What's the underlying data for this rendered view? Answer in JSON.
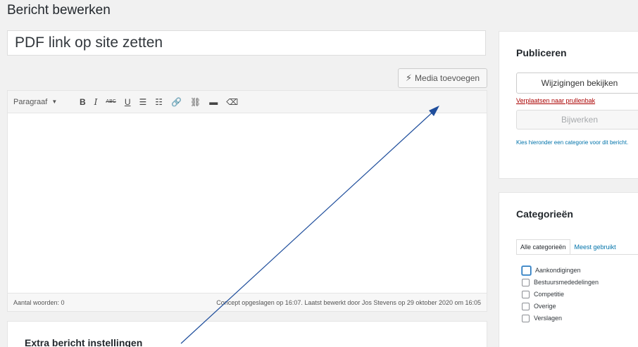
{
  "page": {
    "title": "Bericht bewerken"
  },
  "post": {
    "title": "PDF link op site zetten"
  },
  "editor": {
    "add_media": "Media toevoegen",
    "toolbar": {
      "format": "Paragraaf",
      "bold": "B",
      "italic": "I",
      "strikethrough": "ABC",
      "underline": "U",
      "bullets": "☰",
      "numbers": "☷",
      "link": "🔗",
      "unlink": "⛓",
      "readmore": "▬",
      "clear": "⌫"
    },
    "word_count": "Aantal woorden: 0",
    "save_status": "Concept opgeslagen op 16:07. Laatst bewerkt door Jos Stevens op 29 oktober 2020 om 16:05"
  },
  "extra": {
    "title": "Extra bericht instellingen"
  },
  "publish": {
    "title": "Publiceren",
    "preview": "Wijzigingen bekijken",
    "trash": "Verplaatsen naar prullenbak",
    "update": "Bijwerken",
    "note": "Kies hieronder een categorie voor dit bericht."
  },
  "categories": {
    "title": "Categorieën",
    "tabs": [
      "Alle categorieën",
      "Meest gebruikt"
    ],
    "items": [
      "Aankondigingen",
      "Bestuursmededelingen",
      "Competitie",
      "Overige",
      "Verslagen"
    ]
  },
  "colors": {
    "link": "#0073aa",
    "trash": "#a00",
    "arrow": "#1f4e9c"
  }
}
